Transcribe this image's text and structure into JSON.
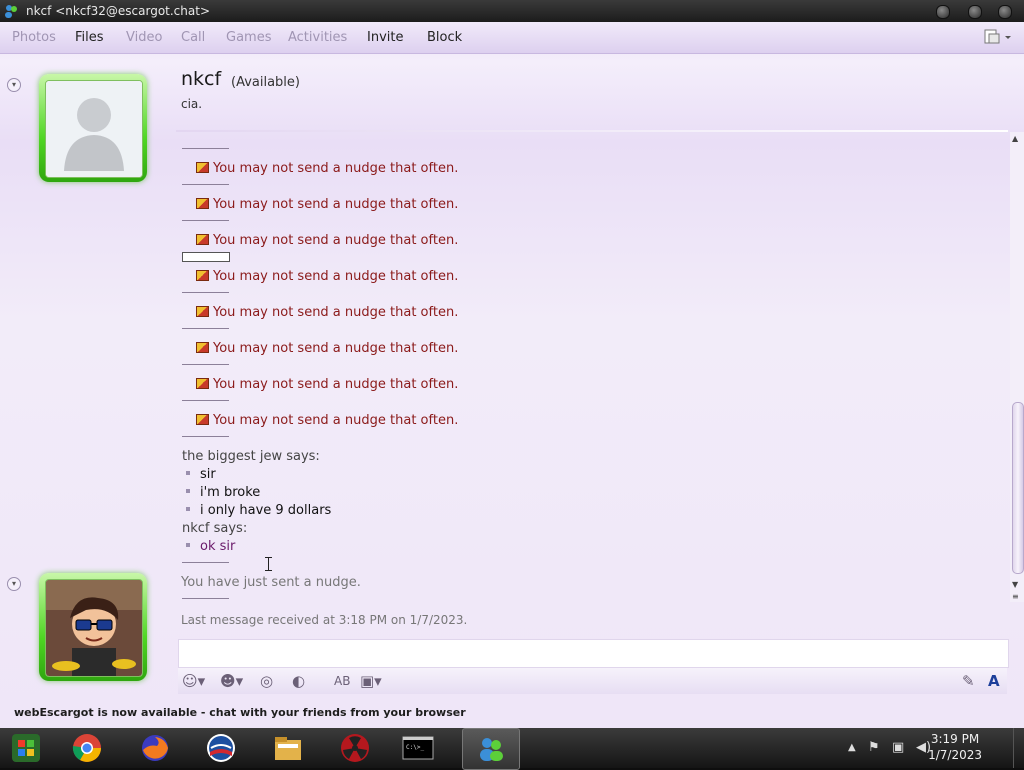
{
  "titlebar": {
    "title": "nkcf <nkcf32@escargot.chat>"
  },
  "menu": {
    "photos": "Photos",
    "files": "Files",
    "video": "Video",
    "call": "Call",
    "games": "Games",
    "activities": "Activities",
    "invite": "Invite",
    "block": "Block"
  },
  "contact": {
    "name": "nkcf",
    "status": "(Available)",
    "personal_message": "cia."
  },
  "conversation": {
    "nudge_warning": "You may not send a nudge that often.",
    "speaker1": "the biggest jew says:",
    "speaker1_lines": [
      "sir",
      "i'm broke",
      "i only have 9 dollars"
    ],
    "speaker2": "nkcf says:",
    "speaker2_lines": [
      "ok sir"
    ]
  },
  "status": {
    "sent_nudge": "You have just sent a nudge.",
    "last_message": "Last message received at 3:18 PM on 1/7/2023."
  },
  "notification": "webEscargot is now available - chat with your friends from your browser",
  "clock": {
    "time": "3:19 PM",
    "date": "1/7/2023"
  },
  "colors": {
    "nudge_text": "#8b1a1a",
    "avatar_frame": "#4fd623"
  }
}
